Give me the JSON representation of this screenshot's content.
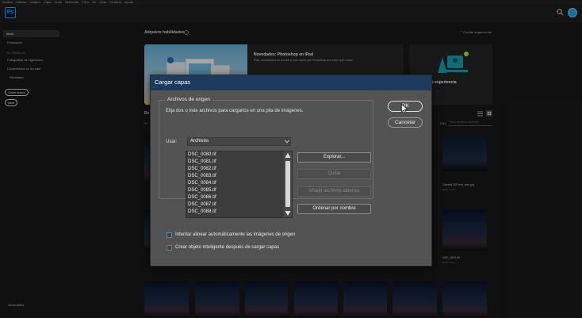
{
  "menubar": [
    "Archivo",
    "Edición",
    "Imagen",
    "Capa",
    "Texto",
    "Selección",
    "Filtro",
    "3D",
    "Vista",
    "Ventana",
    "Ayuda"
  ],
  "header": {
    "logo": "Ps"
  },
  "sidebar": {
    "home": "Inicio",
    "learn": "Formación",
    "section": "TU TRABAJO",
    "items": [
      "Fotografías de Lightroom",
      "Documentos en la nube",
      "Eliminado"
    ],
    "create_new": "Crear nuevo",
    "open": "Abrir",
    "whats_new": "Novedades"
  },
  "main": {
    "title": "Adquiere habilidades",
    "hide_suggestions": "Ocultar sugerencias",
    "hero_title": "Novedades: Photoshop en iPad",
    "hero_desc": "iPad, documentos en la nube y más hacen que Photoshop sea mejor que nunca.",
    "hero2_text": "a experiencia",
    "recent_label": "Re",
    "recent_sub": "Or",
    "filter_label": "Filtro",
    "filter_placeholder": "Filtrar archivos recientes",
    "thumb1_caption": "Cometa 300 mm_web.jpg",
    "thumb1_sub": "Hace 1 mes",
    "thumb2_caption": "DSC_0094.tiff",
    "thumb2_sub": "Hace 1 día"
  },
  "dialog": {
    "title": "Cargar capas",
    "group_title": "Archivos de origen",
    "description": "Elija dos o más archivos para cargarlos en una pila de imágenes.",
    "use_label": "Usar:",
    "use_value": "Archivos",
    "files": [
      "DSC_0080.tif",
      "DSC_0081.tif",
      "DSC_0082.tif",
      "DSC_0083.tif",
      "DSC_0084.tif",
      "DSC_0085.tif",
      "DSC_0086.tif",
      "DSC_0087.tif",
      "DSC_0088.tif"
    ],
    "browse": "Explorar...",
    "remove": "Quitar",
    "add_open": "Añadir archivos abiertos",
    "sort_by_name": "Ordenar por nombre",
    "align_label": "Intentar alinear automáticamente las imágenes de origen",
    "smart_object_label": "Crear objeto inteligente después de cargar capas",
    "ok": "OK",
    "cancel": "Cancelar"
  }
}
